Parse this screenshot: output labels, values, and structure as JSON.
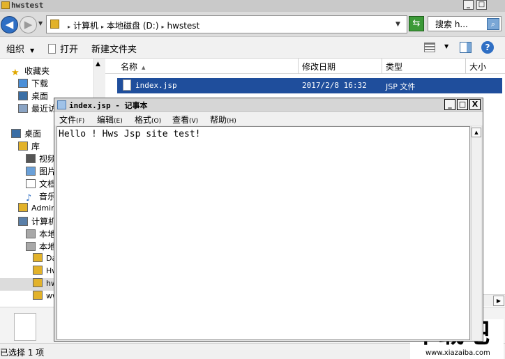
{
  "explorer": {
    "title": "hwstest",
    "window_buttons": {
      "minimize": "_",
      "maximize": "□"
    },
    "nav": {
      "back": "◀",
      "forward": "▶"
    },
    "address": {
      "crumbs": [
        "计算机",
        "本地磁盘 (D:)",
        "hwstest"
      ]
    },
    "search": {
      "text": "搜索 h...",
      "icon": "search-icon"
    },
    "toolbar": {
      "organize": "组织",
      "open": "打开",
      "new_folder": "新建文件夹",
      "help": "?"
    },
    "nav_pane": {
      "items": [
        {
          "label": "收藏夹",
          "icon": "star-icon"
        },
        {
          "label": "下载",
          "icon": "download-folder-icon"
        },
        {
          "label": "桌面",
          "icon": "desktop-icon"
        },
        {
          "label": "最近访问的位置",
          "icon": "recent-icon"
        },
        {
          "label": "桌面",
          "icon": "desktop-icon"
        },
        {
          "label": "库",
          "icon": "library-icon"
        },
        {
          "label": "视频",
          "icon": "video-icon"
        },
        {
          "label": "图片",
          "icon": "picture-icon"
        },
        {
          "label": "文档",
          "icon": "document-icon"
        },
        {
          "label": "音乐",
          "icon": "music-icon"
        },
        {
          "label": "Administrator",
          "icon": "user-icon"
        },
        {
          "label": "计算机",
          "icon": "computer-icon"
        },
        {
          "label": "本地磁盘 (C:)",
          "icon": "drive-icon"
        },
        {
          "label": "本地磁盘 (D:)",
          "icon": "drive-icon"
        },
        {
          "label": "Data",
          "icon": "folder-icon"
        },
        {
          "label": "Hws",
          "icon": "folder-icon"
        },
        {
          "label": "hwstest",
          "icon": "folder-icon"
        },
        {
          "label": "wwwroot",
          "icon": "folder-icon"
        }
      ]
    },
    "list": {
      "columns": [
        "名称",
        "修改日期",
        "类型",
        "大小"
      ],
      "rows": [
        {
          "name": "index.jsp",
          "modified": "2017/2/8 16:32",
          "type": "JSP 文件"
        }
      ]
    },
    "status": "已选择 1 项"
  },
  "notepad": {
    "title": "index.jsp - 记事本",
    "window_buttons": {
      "minimize": "_",
      "maximize": "□",
      "close": "X"
    },
    "menu": [
      {
        "label": "文件",
        "key": "(F)"
      },
      {
        "label": "编辑",
        "key": "(E)"
      },
      {
        "label": "格式",
        "key": "(O)"
      },
      {
        "label": "查看",
        "key": "(V)"
      },
      {
        "label": "帮助",
        "key": "(H)"
      }
    ],
    "content": "Hello ! Hws Jsp site test!"
  },
  "watermark": {
    "main": "下载吧",
    "sub": "www.xiazaiba.com"
  },
  "colors": {
    "selection": "#1f4e9c",
    "titlebar": "#d6d6d6",
    "nav_accent": "#2f6fc4"
  }
}
